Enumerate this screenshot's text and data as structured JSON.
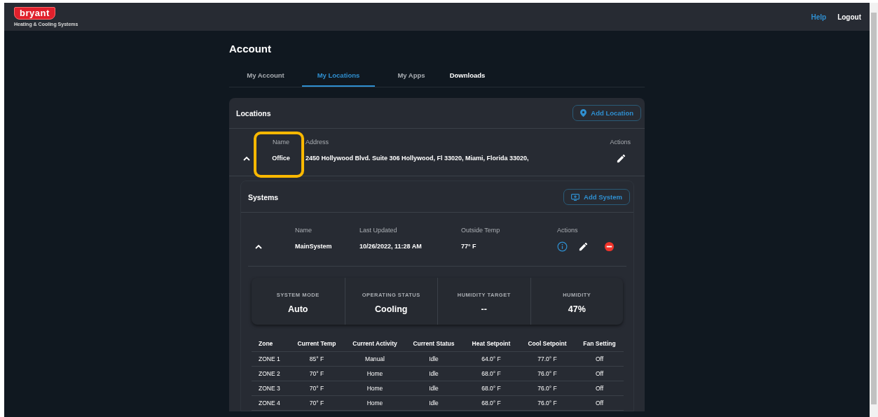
{
  "header": {
    "logo": {
      "brand": "bryant",
      "tagline": "Heating & Cooling Systems"
    },
    "links": [
      {
        "label": "Help",
        "kind": "accent"
      },
      {
        "label": "Logout",
        "kind": "plain"
      }
    ]
  },
  "page_title": "Account",
  "tabs": [
    {
      "label": "My Account",
      "selected": false,
      "highlighted": false
    },
    {
      "label": "My Locations",
      "selected": true,
      "highlighted": false
    },
    {
      "label": "My Apps",
      "selected": false,
      "highlighted": false
    },
    {
      "label": "Downloads",
      "selected": false,
      "highlighted": true
    }
  ],
  "locations": {
    "title": "Locations",
    "add_button": "Add Location",
    "columns": [
      "Name",
      "Address",
      "Actions"
    ],
    "items": [
      {
        "name": "Office",
        "address": "2450 Hollywood Blvd. Suite 306 Hollywood, Fl 33020, Miami, Florida 33020,",
        "expanded": true,
        "highlighted": true,
        "systems": {
          "title": "Systems",
          "add_button": "Add System",
          "columns": [
            "Name",
            "Last Updated",
            "Outside Temp",
            "Actions"
          ],
          "items": [
            {
              "name": "MainSystem",
              "last_updated": "10/26/2022, 11:28 AM",
              "outside_temp": "77° F",
              "expanded": true,
              "stats": [
                {
                  "label": "SYSTEM MODE",
                  "value": "Auto"
                },
                {
                  "label": "OPERATING STATUS",
                  "value": "Cooling"
                },
                {
                  "label": "HUMIDITY TARGET",
                  "value": "--"
                },
                {
                  "label": "HUMIDITY",
                  "value": "47%"
                }
              ],
              "zones": {
                "columns": [
                  "Zone",
                  "Current Temp",
                  "Current Activity",
                  "Current Status",
                  "Heat Setpoint",
                  "Cool Setpoint",
                  "Fan Setting"
                ],
                "rows": [
                  [
                    "ZONE 1",
                    "85° F",
                    "Manual",
                    "Idle",
                    "64.0° F",
                    "77.0° F",
                    "Off"
                  ],
                  [
                    "ZONE 2",
                    "70° F",
                    "Home",
                    "Idle",
                    "68.0° F",
                    "76.0° F",
                    "Off"
                  ],
                  [
                    "ZONE 3",
                    "70° F",
                    "Home",
                    "Idle",
                    "68.0° F",
                    "76.0° F",
                    "Off"
                  ],
                  [
                    "ZONE 4",
                    "70° F",
                    "Home",
                    "Idle",
                    "68.0° F",
                    "76.0° F",
                    "Off"
                  ]
                ]
              }
            }
          ]
        }
      }
    ]
  }
}
